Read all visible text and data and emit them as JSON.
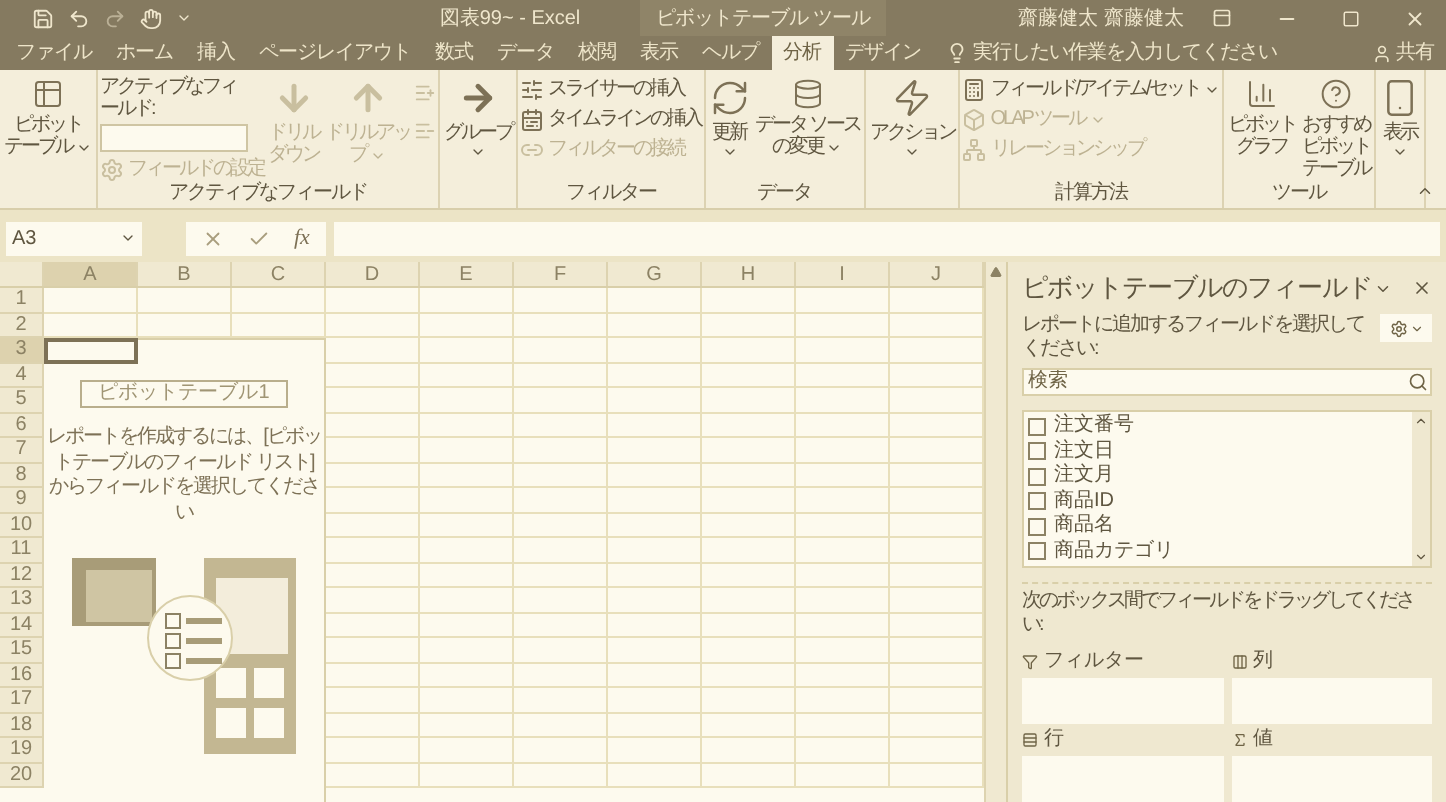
{
  "window": {
    "title": "図表99~ - Excel",
    "contextual_tools": "ピボットテーブル ツール",
    "user": "齋藤健太 齋藤健太"
  },
  "tabs": [
    {
      "label": "ファイル",
      "selected": false
    },
    {
      "label": "ホーム",
      "selected": false
    },
    {
      "label": "挿入",
      "selected": false
    },
    {
      "label": "ページレイアウト",
      "selected": false
    },
    {
      "label": "数式",
      "selected": false
    },
    {
      "label": "データ",
      "selected": false
    },
    {
      "label": "校閲",
      "selected": false
    },
    {
      "label": "表示",
      "selected": false
    },
    {
      "label": "ヘルプ",
      "selected": false
    },
    {
      "label": "分析",
      "selected": true
    },
    {
      "label": "デザイン",
      "selected": false
    }
  ],
  "tell_me": {
    "text": "実行したい作業を入力してください"
  },
  "share": {
    "label": "共有"
  },
  "ribbon": {
    "groups": [
      {
        "items": [
          {
            "kind": "large",
            "lines": [
              "ピボット",
              "テーブル"
            ],
            "dropdown": true,
            "disabled": false
          }
        ]
      },
      {
        "label": "アクティブなフィールド",
        "items": [
          {
            "kind": "stack",
            "items": [
              {
                "kind": "text",
                "text": "アクティブなフィールド:"
              },
              {
                "kind": "input"
              },
              {
                "kind": "small",
                "label": "フィールドの設定",
                "disabled": true
              }
            ]
          },
          {
            "kind": "large",
            "lines": [
              "ドリル",
              "ダウン"
            ],
            "dropdown": false,
            "disabled": true
          },
          {
            "kind": "large",
            "lines": [
              "ドリルアッ",
              "プ"
            ],
            "dropdown": true,
            "disabled": true
          },
          {
            "kind": "icon-pair",
            "disabled": true
          }
        ]
      },
      {
        "items": [
          {
            "kind": "large",
            "lines": [
              "グループ"
            ],
            "dropdown": true,
            "disabled": false
          }
        ]
      },
      {
        "label": "フィルター",
        "items": [
          {
            "kind": "stack",
            "items": [
              {
                "kind": "small",
                "label": "スライサーの挿入",
                "disabled": false
              },
              {
                "kind": "small",
                "label": "タイムラインの挿入",
                "disabled": false
              },
              {
                "kind": "small",
                "label": "フィルターの接続",
                "disabled": true
              }
            ]
          }
        ]
      },
      {
        "label": "データ",
        "items": [
          {
            "kind": "large",
            "lines": [
              "更新"
            ],
            "dropdown": true,
            "disabled": false
          },
          {
            "kind": "large",
            "lines": [
              "データ ソース",
              "の変更"
            ],
            "dropdown": true,
            "disabled": false
          }
        ]
      },
      {
        "items": [
          {
            "kind": "large",
            "lines": [
              "アクション"
            ],
            "dropdown": true,
            "disabled": false
          }
        ]
      },
      {
        "label": "計算方法",
        "items": [
          {
            "kind": "stack",
            "items": [
              {
                "kind": "small",
                "label": "フィールド/アイテム/セット",
                "dropdown": true,
                "disabled": false
              },
              {
                "kind": "small",
                "label": "OLAP ツール",
                "dropdown": true,
                "disabled": true
              },
              {
                "kind": "small",
                "label": "リレーションシップ",
                "disabled": true
              }
            ]
          }
        ]
      },
      {
        "label": "ツール",
        "items": [
          {
            "kind": "large",
            "lines": [
              "ピボット",
              "グラフ"
            ],
            "dropdown": false,
            "disabled": false
          },
          {
            "kind": "large",
            "lines": [
              "おすすめ",
              "ピボット",
              "テーブル"
            ],
            "dropdown": false,
            "disabled": false
          }
        ]
      },
      {
        "items": [
          {
            "kind": "large",
            "lines": [
              "表示"
            ],
            "dropdown": true,
            "disabled": false
          }
        ]
      }
    ]
  },
  "formula_bar": {
    "name_box": "A3",
    "function_button": "fx"
  },
  "columns": [
    {
      "label": "A",
      "selected": true
    },
    {
      "label": "B",
      "selected": false
    },
    {
      "label": "C",
      "selected": false
    },
    {
      "label": "D",
      "selected": false
    },
    {
      "label": "E",
      "selected": false
    },
    {
      "label": "F",
      "selected": false
    },
    {
      "label": "G",
      "selected": false
    },
    {
      "label": "H",
      "selected": false
    },
    {
      "label": "I",
      "selected": false
    },
    {
      "label": "J",
      "selected": false
    }
  ],
  "rows": [
    {
      "label": "1",
      "selected": false
    },
    {
      "label": "2",
      "selected": false
    },
    {
      "label": "3",
      "selected": true
    },
    {
      "label": "4",
      "selected": false
    },
    {
      "label": "5",
      "selected": false
    },
    {
      "label": "6",
      "selected": false
    },
    {
      "label": "7",
      "selected": false
    },
    {
      "label": "8",
      "selected": false
    },
    {
      "label": "9",
      "selected": false
    },
    {
      "label": "10",
      "selected": false
    },
    {
      "label": "11",
      "selected": false
    },
    {
      "label": "12",
      "selected": false
    },
    {
      "label": "13",
      "selected": false
    },
    {
      "label": "14",
      "selected": false
    },
    {
      "label": "15",
      "selected": false
    },
    {
      "label": "16",
      "selected": false
    },
    {
      "label": "17",
      "selected": false
    },
    {
      "label": "18",
      "selected": false
    },
    {
      "label": "19",
      "selected": false
    },
    {
      "label": "20",
      "selected": false
    }
  ],
  "pivot_placeholder": {
    "name": "ピボットテーブル1",
    "message": "レポートを作成するには、[ピボットテーブルのフィールド リスト] からフィールドを選択してください"
  },
  "field_pane": {
    "title": "ピボットテーブルのフィールド",
    "instruction": "レポートに追加するフィールドを選択してください:",
    "search": {
      "placeholder": "検索"
    },
    "fields": [
      {
        "label": "注文番号",
        "checked": false
      },
      {
        "label": "注文日",
        "checked": false
      },
      {
        "label": "注文月",
        "checked": false
      },
      {
        "label": "商品ID",
        "checked": false
      },
      {
        "label": "商品名",
        "checked": false
      },
      {
        "label": "商品カテゴリ",
        "checked": false
      }
    ],
    "drag_hint": "次のボックス間でフィールドをドラッグしてください:",
    "areas": [
      {
        "label": "フィルター"
      },
      {
        "label": "列"
      },
      {
        "label": "行"
      },
      {
        "label": "値"
      }
    ]
  }
}
